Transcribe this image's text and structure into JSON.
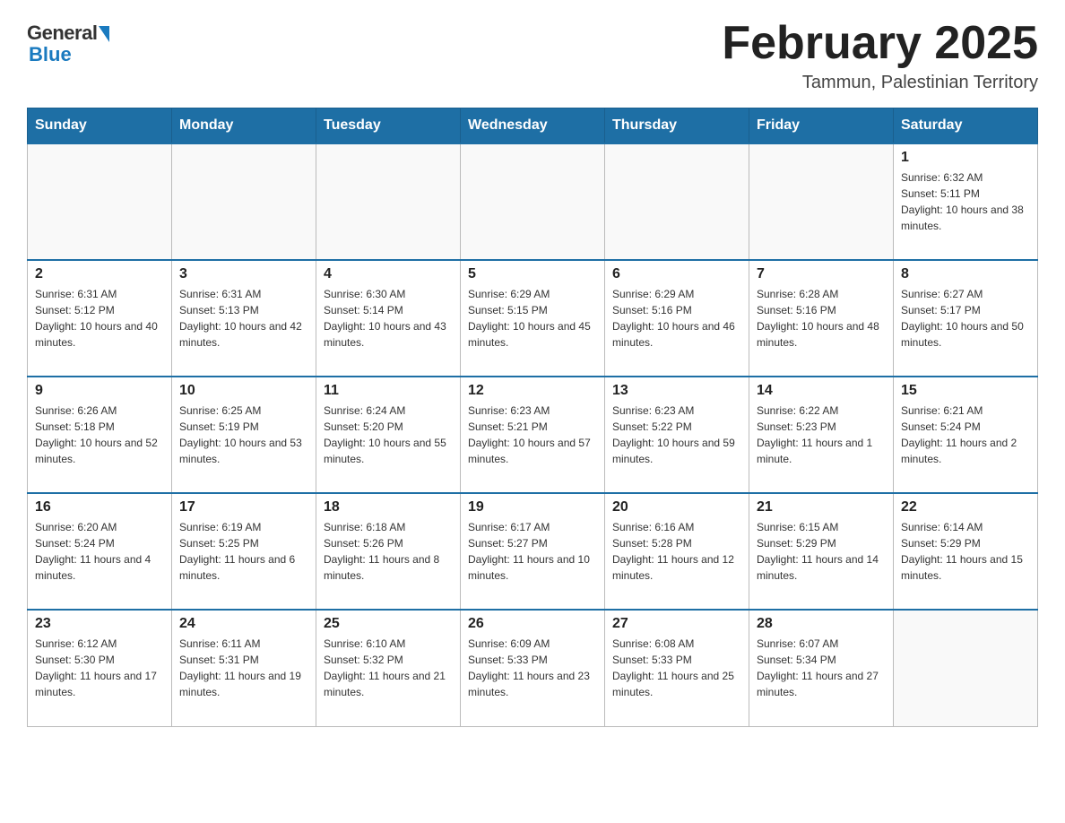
{
  "logo": {
    "general": "General",
    "blue": "Blue"
  },
  "header": {
    "month": "February 2025",
    "location": "Tammun, Palestinian Territory"
  },
  "weekdays": [
    "Sunday",
    "Monday",
    "Tuesday",
    "Wednesday",
    "Thursday",
    "Friday",
    "Saturday"
  ],
  "weeks": [
    [
      {
        "day": "",
        "sunrise": "",
        "sunset": "",
        "daylight": ""
      },
      {
        "day": "",
        "sunrise": "",
        "sunset": "",
        "daylight": ""
      },
      {
        "day": "",
        "sunrise": "",
        "sunset": "",
        "daylight": ""
      },
      {
        "day": "",
        "sunrise": "",
        "sunset": "",
        "daylight": ""
      },
      {
        "day": "",
        "sunrise": "",
        "sunset": "",
        "daylight": ""
      },
      {
        "day": "",
        "sunrise": "",
        "sunset": "",
        "daylight": ""
      },
      {
        "day": "1",
        "sunrise": "Sunrise: 6:32 AM",
        "sunset": "Sunset: 5:11 PM",
        "daylight": "Daylight: 10 hours and 38 minutes."
      }
    ],
    [
      {
        "day": "2",
        "sunrise": "Sunrise: 6:31 AM",
        "sunset": "Sunset: 5:12 PM",
        "daylight": "Daylight: 10 hours and 40 minutes."
      },
      {
        "day": "3",
        "sunrise": "Sunrise: 6:31 AM",
        "sunset": "Sunset: 5:13 PM",
        "daylight": "Daylight: 10 hours and 42 minutes."
      },
      {
        "day": "4",
        "sunrise": "Sunrise: 6:30 AM",
        "sunset": "Sunset: 5:14 PM",
        "daylight": "Daylight: 10 hours and 43 minutes."
      },
      {
        "day": "5",
        "sunrise": "Sunrise: 6:29 AM",
        "sunset": "Sunset: 5:15 PM",
        "daylight": "Daylight: 10 hours and 45 minutes."
      },
      {
        "day": "6",
        "sunrise": "Sunrise: 6:29 AM",
        "sunset": "Sunset: 5:16 PM",
        "daylight": "Daylight: 10 hours and 46 minutes."
      },
      {
        "day": "7",
        "sunrise": "Sunrise: 6:28 AM",
        "sunset": "Sunset: 5:16 PM",
        "daylight": "Daylight: 10 hours and 48 minutes."
      },
      {
        "day": "8",
        "sunrise": "Sunrise: 6:27 AM",
        "sunset": "Sunset: 5:17 PM",
        "daylight": "Daylight: 10 hours and 50 minutes."
      }
    ],
    [
      {
        "day": "9",
        "sunrise": "Sunrise: 6:26 AM",
        "sunset": "Sunset: 5:18 PM",
        "daylight": "Daylight: 10 hours and 52 minutes."
      },
      {
        "day": "10",
        "sunrise": "Sunrise: 6:25 AM",
        "sunset": "Sunset: 5:19 PM",
        "daylight": "Daylight: 10 hours and 53 minutes."
      },
      {
        "day": "11",
        "sunrise": "Sunrise: 6:24 AM",
        "sunset": "Sunset: 5:20 PM",
        "daylight": "Daylight: 10 hours and 55 minutes."
      },
      {
        "day": "12",
        "sunrise": "Sunrise: 6:23 AM",
        "sunset": "Sunset: 5:21 PM",
        "daylight": "Daylight: 10 hours and 57 minutes."
      },
      {
        "day": "13",
        "sunrise": "Sunrise: 6:23 AM",
        "sunset": "Sunset: 5:22 PM",
        "daylight": "Daylight: 10 hours and 59 minutes."
      },
      {
        "day": "14",
        "sunrise": "Sunrise: 6:22 AM",
        "sunset": "Sunset: 5:23 PM",
        "daylight": "Daylight: 11 hours and 1 minute."
      },
      {
        "day": "15",
        "sunrise": "Sunrise: 6:21 AM",
        "sunset": "Sunset: 5:24 PM",
        "daylight": "Daylight: 11 hours and 2 minutes."
      }
    ],
    [
      {
        "day": "16",
        "sunrise": "Sunrise: 6:20 AM",
        "sunset": "Sunset: 5:24 PM",
        "daylight": "Daylight: 11 hours and 4 minutes."
      },
      {
        "day": "17",
        "sunrise": "Sunrise: 6:19 AM",
        "sunset": "Sunset: 5:25 PM",
        "daylight": "Daylight: 11 hours and 6 minutes."
      },
      {
        "day": "18",
        "sunrise": "Sunrise: 6:18 AM",
        "sunset": "Sunset: 5:26 PM",
        "daylight": "Daylight: 11 hours and 8 minutes."
      },
      {
        "day": "19",
        "sunrise": "Sunrise: 6:17 AM",
        "sunset": "Sunset: 5:27 PM",
        "daylight": "Daylight: 11 hours and 10 minutes."
      },
      {
        "day": "20",
        "sunrise": "Sunrise: 6:16 AM",
        "sunset": "Sunset: 5:28 PM",
        "daylight": "Daylight: 11 hours and 12 minutes."
      },
      {
        "day": "21",
        "sunrise": "Sunrise: 6:15 AM",
        "sunset": "Sunset: 5:29 PM",
        "daylight": "Daylight: 11 hours and 14 minutes."
      },
      {
        "day": "22",
        "sunrise": "Sunrise: 6:14 AM",
        "sunset": "Sunset: 5:29 PM",
        "daylight": "Daylight: 11 hours and 15 minutes."
      }
    ],
    [
      {
        "day": "23",
        "sunrise": "Sunrise: 6:12 AM",
        "sunset": "Sunset: 5:30 PM",
        "daylight": "Daylight: 11 hours and 17 minutes."
      },
      {
        "day": "24",
        "sunrise": "Sunrise: 6:11 AM",
        "sunset": "Sunset: 5:31 PM",
        "daylight": "Daylight: 11 hours and 19 minutes."
      },
      {
        "day": "25",
        "sunrise": "Sunrise: 6:10 AM",
        "sunset": "Sunset: 5:32 PM",
        "daylight": "Daylight: 11 hours and 21 minutes."
      },
      {
        "day": "26",
        "sunrise": "Sunrise: 6:09 AM",
        "sunset": "Sunset: 5:33 PM",
        "daylight": "Daylight: 11 hours and 23 minutes."
      },
      {
        "day": "27",
        "sunrise": "Sunrise: 6:08 AM",
        "sunset": "Sunset: 5:33 PM",
        "daylight": "Daylight: 11 hours and 25 minutes."
      },
      {
        "day": "28",
        "sunrise": "Sunrise: 6:07 AM",
        "sunset": "Sunset: 5:34 PM",
        "daylight": "Daylight: 11 hours and 27 minutes."
      },
      {
        "day": "",
        "sunrise": "",
        "sunset": "",
        "daylight": ""
      }
    ]
  ]
}
